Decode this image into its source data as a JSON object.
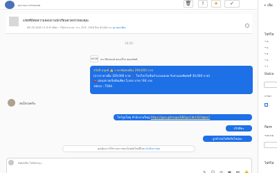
{
  "header": {
    "subtitle": "ผลงานความรักดบทพ",
    "buttons": [
      "trash-icon",
      "alert-icon",
      "star-icon",
      "check-icon"
    ]
  },
  "product": {
    "title": "แชทที่มีต่อความสอบถามนักเรียนคาดหวังของคุณ",
    "meta": "MG ZS 2018 1.5 D AT สต็อก : T004 ประเภท : กระ 25 ปี : 2018 ปีรุ่น 81,000 กม.",
    "link": "ดูรายละเอียด"
  },
  "chat": {
    "time": "16:26",
    "quote_badge": "16:26",
    "quote_text": "ประวัติรถยนต์ ผ่อนกกี่รถ ผ่อนทรัพท์",
    "message_lines": [
      "สวัสดี มนุษย์ 👍 ราคาพิเศษเพียง 299,000 บาท",
      "(จากราคาเต็ม 329,000 บาท 🔻 โปรไปรโมชั่นจำนวนลดลด รับส่วนลดพิเศษที่ 30,000 บาท)",
      "🚗 ผ่อนสบายเริ่มต้นเพียง 5,xxx บาท / 84 งวด",
      "รหัสรถ : T004"
    ],
    "seller_name": "สนใจรถครับ",
    "link_message": "โชว์รูมโตคุ สำนักงานใหญ่",
    "link_url": "https://goo.gl/maps/SBGpcCdkC923qba7",
    "reply1": "สวัสดีคะ",
    "reply2": "ลูกค้าสนใจดีครับไหมคะ",
    "notice_text": "คุณต้องการให้ระบบการตอบโดยอัตโนมัติไหม",
    "notice_link": "ดำเนินการต่อ"
  },
  "composer": {
    "placeholder": "ตอบกลับ โปรดระบุ..."
  },
  "right_panel": {
    "add_label": "+ เพิ่ม",
    "section1": "ไปรโฟ",
    "bullets": [
      "• ค",
      "• ป",
      "• ส",
      "• ม",
      "• ร"
    ],
    "section2": "Outco",
    "label2": "การยา",
    "section3": "กิจกร",
    "label3": "ระยะเวล",
    "section4": "ไปรโฟ"
  }
}
